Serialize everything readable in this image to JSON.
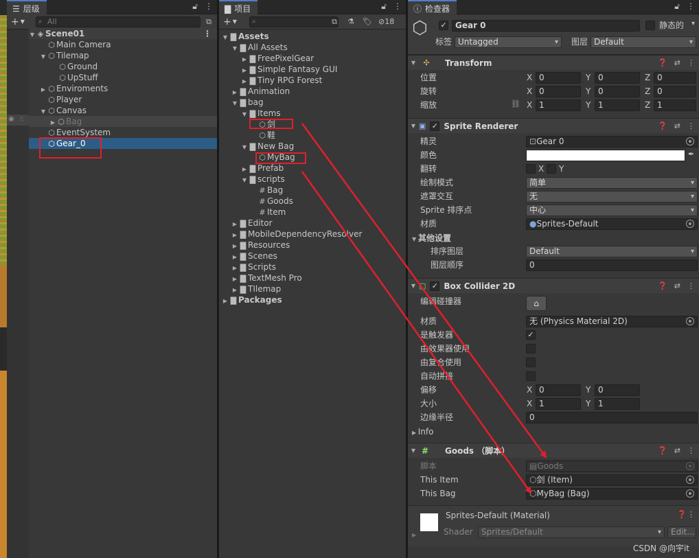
{
  "hierarchy": {
    "tab": "层级",
    "search_placeholder": "All",
    "items": [
      {
        "label": "Scene01"
      },
      {
        "label": "Main Camera"
      },
      {
        "label": "Tilemap"
      },
      {
        "label": "Ground"
      },
      {
        "label": "UpStuff"
      },
      {
        "label": "Enviroments"
      },
      {
        "label": "Player"
      },
      {
        "label": "Canvas"
      },
      {
        "label": "Bag"
      },
      {
        "label": "EventSystem"
      },
      {
        "label": "Gear_0"
      }
    ]
  },
  "project": {
    "tab": "项目",
    "hidden_count": "18",
    "items": [
      {
        "label": "Assets"
      },
      {
        "label": "All Assets"
      },
      {
        "label": "FreePixelGear"
      },
      {
        "label": "Simple Fantasy GUI"
      },
      {
        "label": "Tiny RPG Forest"
      },
      {
        "label": "Animation"
      },
      {
        "label": "bag"
      },
      {
        "label": "Items"
      },
      {
        "label": "剑"
      },
      {
        "label": "鞋"
      },
      {
        "label": "New Bag"
      },
      {
        "label": "MyBag"
      },
      {
        "label": "Prefab"
      },
      {
        "label": "scripts"
      },
      {
        "label": "Bag"
      },
      {
        "label": "Goods"
      },
      {
        "label": "Item"
      },
      {
        "label": "Editor"
      },
      {
        "label": "MobileDependencyResolver"
      },
      {
        "label": "Resources"
      },
      {
        "label": "Scenes"
      },
      {
        "label": "Scripts"
      },
      {
        "label": "TextMesh Pro"
      },
      {
        "label": "TIlemap"
      },
      {
        "label": "Packages"
      }
    ]
  },
  "inspector": {
    "tab": "检查器",
    "object_name": "Gear 0",
    "static_label": "静态的",
    "tag_label": "标签",
    "tag_value": "Untagged",
    "layer_label": "图层",
    "layer_value": "Default",
    "transform": {
      "title": "Transform",
      "position": "位置",
      "rotation": "旋转",
      "scale": "缩放",
      "x": "X",
      "y": "Y",
      "z": "Z",
      "pos": [
        "0",
        "0",
        "0"
      ],
      "rot": [
        "0",
        "0",
        "0"
      ],
      "scl": [
        "1",
        "1",
        "1"
      ]
    },
    "sprite_renderer": {
      "title": "Sprite Renderer",
      "sprite_label": "精灵",
      "sprite_value": "Gear 0",
      "color_label": "颜色",
      "flip_label": "翻转",
      "flip_x": "X",
      "flip_y": "Y",
      "draw_mode_label": "绘制模式",
      "draw_mode_value": "简单",
      "mask_label": "遮罩交互",
      "mask_value": "无",
      "sort_point_label": "Sprite 排序点",
      "sort_point_value": "中心",
      "material_label": "材质",
      "material_value": "Sprites-Default",
      "other_label": "其他设置",
      "sorting_layer_label": "排序图层",
      "sorting_layer_value": "Default",
      "order_label": "图层顺序",
      "order_value": "0"
    },
    "box_collider": {
      "title": "Box Collider 2D",
      "edit_label": "编辑碰撞器",
      "material_label": "材质",
      "material_value": "无 (Physics Material 2D)",
      "trigger_label": "是触发器",
      "effector_label": "由效果器使用",
      "composite_label": "由复合使用",
      "autotiling_label": "自动拼接",
      "offset_label": "偏移",
      "offset": [
        "0",
        "0"
      ],
      "size_label": "大小",
      "size": [
        "1",
        "1"
      ],
      "edge_label": "边缘半径",
      "edge_value": "0",
      "info_label": "Info",
      "x": "X",
      "y": "Y"
    },
    "goods": {
      "title": "Goods （脚本）",
      "script_label": "脚本",
      "script_value": "Goods",
      "item_label": "This Item",
      "item_value": "剑 (Item)",
      "bag_label": "This Bag",
      "bag_value": "MyBag (Bag)"
    },
    "material": {
      "title": "Sprites-Default (Material)",
      "shader_label": "Shader",
      "shader_value": "Sprites/Default",
      "edit_label": "Edit..."
    }
  },
  "watermark": "CSDN @向宇it"
}
